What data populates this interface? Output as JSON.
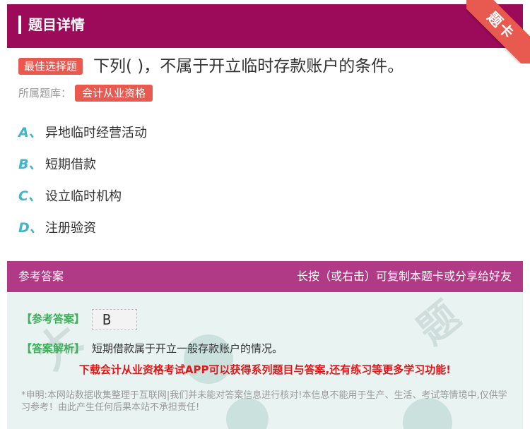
{
  "header": {
    "title": "题目详情"
  },
  "ribbon": {
    "label": "题卡"
  },
  "question": {
    "type_tag": "最佳选择题",
    "text": "下列( )，不属于开立临时存款账户的条件。",
    "library_label": "所属题库：",
    "library_tag": "会计从业资格"
  },
  "options": [
    {
      "letter": "A、",
      "text": "异地临时经营活动"
    },
    {
      "letter": "B、",
      "text": "短期借款"
    },
    {
      "letter": "C、",
      "text": "设立临时机构"
    },
    {
      "letter": "D、",
      "text": "注册验资"
    }
  ],
  "answer_section": {
    "title": "参考答案",
    "hint": "长按（或右击）可复制本题卡或分享给好友",
    "ref_label": "【参考答案】",
    "ref_value": "B",
    "exp_label": "【答案解析】",
    "exp_text": "短期借款属于开立一般存款账户的情况。",
    "download": "下载会计从业资格考试APP可以获得系列题目与答案,还有练习等更多学习功能!",
    "disclaimer": "*申明:本网站数据收集整理于互联网|我们并未能对答案信息进行核对!本信息不能用于生产、生活、考试等情境中,仅供学习参考！由此产生任何后果本站不承担责任!"
  },
  "colors": {
    "header_bg": "#9c0a5a",
    "tag_bg": "#e8594f",
    "option_letter": "#3fb6c9",
    "answer_header_bg": "#b03a85",
    "answer_body_bg": "#e9f4f2",
    "label_green": "#3fae5a",
    "download_red": "#e01818"
  }
}
